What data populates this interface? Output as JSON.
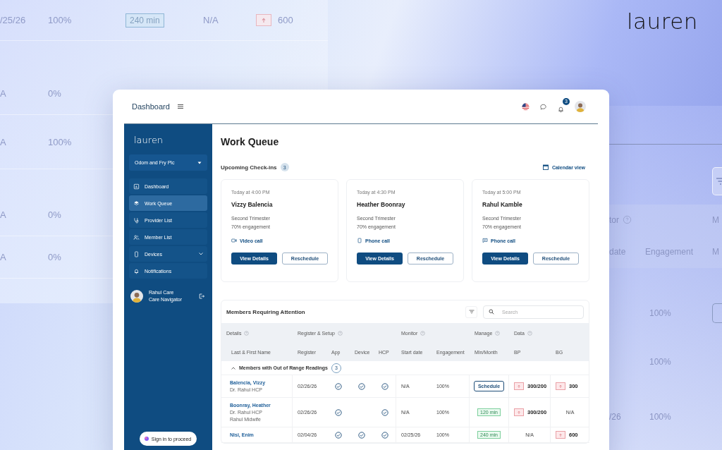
{
  "brand_logo": {
    "text": "lauren"
  },
  "background": {
    "left_table": {
      "rows": [
        {
          "cells": [
            {
              "kind": "text",
              "text": "/25/26"
            },
            {
              "kind": "text",
              "text": "100%"
            },
            {
              "kind": "badge",
              "text": "240 min"
            },
            {
              "kind": "text",
              "text": "N/A"
            },
            {
              "kind": "alert",
              "text": "600"
            }
          ]
        },
        {
          "cells": [
            {
              "kind": "text",
              "text": "A"
            },
            {
              "kind": "text",
              "text": "0%"
            }
          ]
        },
        {
          "cells": [
            {
              "kind": "text",
              "text": "A"
            },
            {
              "kind": "text",
              "text": "100%"
            }
          ]
        },
        {
          "cells": [
            {
              "kind": "text",
              "text": "A"
            },
            {
              "kind": "text",
              "text": "0%"
            }
          ]
        },
        {
          "cells": [
            {
              "kind": "text",
              "text": "A"
            },
            {
              "kind": "text",
              "text": "0%"
            }
          ]
        }
      ]
    },
    "right_table": {
      "group_headers": [
        "tor",
        "M"
      ],
      "column_headers": [
        "date",
        "Engagement",
        "M"
      ],
      "rows": [
        {
          "engagement": "100%",
          "manage_button": true
        },
        {
          "engagement": "100%",
          "manage_button": false
        },
        {
          "date": "/26",
          "engagement": "100%",
          "manage_button": false
        }
      ]
    }
  },
  "window": {
    "title": "Dashboard",
    "notification_count": "3"
  },
  "sidebar": {
    "logo": "lauren",
    "organization": "Odom and Fry Plc",
    "items": [
      {
        "label": "Dashboard",
        "kind": "chart",
        "selected": false,
        "has_submenu": false
      },
      {
        "label": "Work Queue",
        "kind": "layers",
        "selected": true,
        "has_submenu": false
      },
      {
        "label": "Provider List",
        "kind": "stethoscope",
        "selected": false,
        "has_submenu": false
      },
      {
        "label": "Member List",
        "kind": "people",
        "selected": false,
        "has_submenu": false
      },
      {
        "label": "Devices",
        "kind": "phone",
        "selected": false,
        "has_submenu": true
      },
      {
        "label": "Notifications",
        "kind": "bell",
        "selected": false,
        "has_submenu": false
      }
    ],
    "user": {
      "name": "Rahul Care",
      "role": "Care Navigator"
    },
    "sign_in_button": "Sign in to proceed"
  },
  "page": {
    "title": "Work Queue",
    "checkins": {
      "title": "Upcoming Check-ins",
      "count": "3",
      "calendar_link": "Calendar view",
      "cards": [
        {
          "time": "Today at 4:00 PM",
          "name": "Vizzy Balencia",
          "stage": "Second Trimester",
          "engagement": "70% engagement",
          "contact": {
            "kind": "video",
            "label": "Video call"
          },
          "primary_button": "View Details",
          "secondary_button": "Reschedule"
        },
        {
          "time": "Today at 4:30 PM",
          "name": "Heather Boonray",
          "stage": "Second Trimester",
          "engagement": "70% engagement",
          "contact": {
            "kind": "phone",
            "label": "Phone call"
          },
          "primary_button": "View Details",
          "secondary_button": "Reschedule"
        },
        {
          "time": "Today at 5:00 PM",
          "name": "Rahul Kamble",
          "stage": "Second Trimester",
          "engagement": "70% engagement",
          "contact": {
            "kind": "message",
            "label": "Phone call"
          },
          "primary_button": "View Details",
          "secondary_button": "Reschedule"
        }
      ]
    },
    "members": {
      "title": "Members Requiring Attention",
      "search_placeholder": "Search",
      "column_groups": [
        {
          "label": "Details",
          "columns": [
            "Last & First Name"
          ]
        },
        {
          "label": "Register & Setup",
          "columns": [
            "Register",
            "App",
            "Device",
            "HCP"
          ]
        },
        {
          "label": "Monitor",
          "columns": [
            "Start date",
            "Engagement"
          ]
        },
        {
          "label": "Manage",
          "columns": [
            "Min/Month"
          ]
        },
        {
          "label": "Data",
          "columns": [
            "BP",
            "BG"
          ]
        }
      ],
      "section": {
        "title": "Members with Out of Range Readings",
        "count": "3",
        "expanded": true
      },
      "rows": [
        {
          "name": "Balencia, Vizzy",
          "details": [
            "Dr. Rahul HCP"
          ],
          "register": "02/26/26",
          "app": true,
          "device": true,
          "hcp": true,
          "start_date": "N/A",
          "engagement": "100%",
          "manage": {
            "kind": "button",
            "text": "Schedule"
          },
          "bp": {
            "value": "300/200",
            "alert": true
          },
          "bg": {
            "value": "300",
            "alert": true
          }
        },
        {
          "name": "Boonray, Heather",
          "details": [
            "Dr. Rahul HCP",
            "Rahul Midwife"
          ],
          "register": "02/26/26",
          "app": true,
          "device": false,
          "hcp": true,
          "start_date": "N/A",
          "engagement": "100%",
          "manage": {
            "kind": "badge",
            "text": "120 min"
          },
          "bp": {
            "value": "300/200",
            "alert": true
          },
          "bg": {
            "value": "N/A",
            "alert": false
          }
        },
        {
          "name": "Nisi, Enim",
          "details": [],
          "register": "02/04/26",
          "app": true,
          "device": true,
          "hcp": true,
          "start_date": "02/25/26",
          "engagement": "100%",
          "manage": {
            "kind": "badge",
            "text": "240 min"
          },
          "bp": {
            "value": "N/A",
            "alert": false
          },
          "bg": {
            "value": "600",
            "alert": true
          }
        }
      ]
    }
  }
}
